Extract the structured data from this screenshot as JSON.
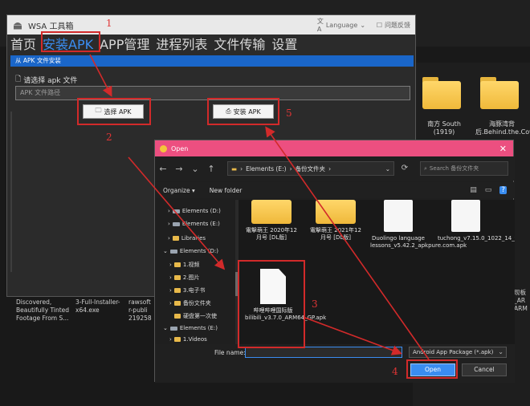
{
  "app": {
    "title": "WSA 工具箱",
    "language_label": "Language",
    "feedback_label": "问题反馈",
    "tabs": [
      {
        "label": "首页"
      },
      {
        "label": "安装APK"
      },
      {
        "label": "APP管理"
      },
      {
        "label": "进程列表"
      },
      {
        "label": "文件传输"
      },
      {
        "label": "设置"
      }
    ],
    "active_tab_index": 1,
    "section_title": "从 APK 文件安装",
    "file_label": "请选择 apk 文件",
    "path_placeholder": "APK 文件路径",
    "select_button": "选择 APK",
    "install_button": "安装 APK"
  },
  "annotations": [
    "1",
    "2",
    "3",
    "4",
    "5"
  ],
  "dialog": {
    "title": "Open",
    "breadcrumb": [
      "Elements (E:)",
      "备份文件夹"
    ],
    "search_placeholder": "Search 备份文件夹",
    "organize_label": "Organize",
    "new_folder_label": "New folder",
    "tree": [
      {
        "label": "Elements (D:)",
        "type": "drive"
      },
      {
        "label": "Elements (E:)",
        "type": "drive"
      },
      {
        "label": "Libraries",
        "type": "folder"
      },
      {
        "label": "Elements (D:)",
        "type": "drive"
      },
      {
        "label": "1.视频",
        "type": "folder"
      },
      {
        "label": "2.图片",
        "type": "folder"
      },
      {
        "label": "3.电子书",
        "type": "folder"
      },
      {
        "label": "备份文件夹",
        "type": "folder"
      },
      {
        "label": "硬盘第一次使",
        "type": "folder"
      },
      {
        "label": "Elements (E:)",
        "type": "drive"
      },
      {
        "label": "1.Videos",
        "type": "folder"
      }
    ],
    "files": [
      {
        "label": "電擊萌王 2020年12月号 [DL版]",
        "kind": "folder"
      },
      {
        "label": "電擊萌王 2021年12月号 [DL版]",
        "kind": "folder"
      },
      {
        "label": "Duolingo language lessons_v5.42.2_apkpure.com.apk",
        "kind": "apk"
      },
      {
        "label": "tuchong_v7.15.0_1022_14_tuchong.apk",
        "kind": "apk"
      },
      {
        "label": "哔哩哔哩国际版bilibili_v3.7.0_ARM64_GP.apk",
        "kind": "file"
      }
    ],
    "filename_label": "File name:",
    "filetype": "Android App Package (*.apk)",
    "open_button": "Open",
    "cancel_button": "Cancel"
  },
  "desktop": {
    "folders": [
      {
        "label": "南方 South (1919)"
      },
      {
        "label": "海豚湾背后.Behind.the.Cove.2015"
      }
    ],
    "texts": [
      "Discovered, Beautifully Tinted Footage From S...",
      "3-Full-Installer-x64.exe",
      "rawsoft r-publi 219258",
      "现板 _AR ARM"
    ]
  }
}
